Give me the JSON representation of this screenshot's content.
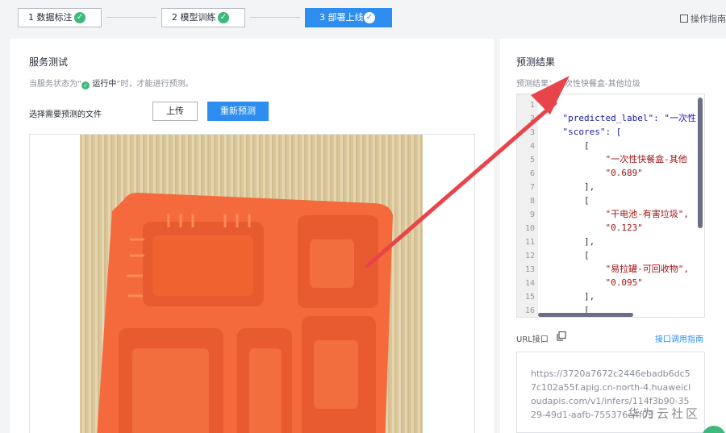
{
  "steps": [
    {
      "label": "1 数据标注",
      "status": "done"
    },
    {
      "label": "2 模型训练",
      "status": "done"
    },
    {
      "label": "3 部署上线",
      "status": "active"
    }
  ],
  "guide_label": "操作指南",
  "service_test": {
    "title": "服务测试",
    "hint_prefix": "当服务状态为“",
    "hint_status": "运行中",
    "hint_suffix": "”时，才能进行预测。",
    "file_label": "选择需要预测的文件",
    "upload_label": "上传",
    "repredict_label": "重新预测"
  },
  "result": {
    "title": "预测结果",
    "text": "预测结果：一次性快餐盒-其他垃圾",
    "code_lines": [
      {
        "n": "1",
        "t": "{"
      },
      {
        "n": "2",
        "t": "    \"predicted_label\": \"一次性"
      },
      {
        "n": "3",
        "t": "    \"scores\": ["
      },
      {
        "n": "4",
        "t": "        ["
      },
      {
        "n": "5",
        "t": "            \"一次性快餐盒-其他"
      },
      {
        "n": "6",
        "t": "            \"0.689\""
      },
      {
        "n": "7",
        "t": "        ],"
      },
      {
        "n": "8",
        "t": "        ["
      },
      {
        "n": "9",
        "t": "            \"干电池-有害垃圾\","
      },
      {
        "n": "10",
        "t": "            \"0.123\""
      },
      {
        "n": "11",
        "t": "        ],"
      },
      {
        "n": "12",
        "t": "        ["
      },
      {
        "n": "13",
        "t": "            \"易拉罐-可回收物\","
      },
      {
        "n": "14",
        "t": "            \"0.095\""
      },
      {
        "n": "15",
        "t": "        ],"
      },
      {
        "n": "16",
        "t": "        ["
      }
    ]
  },
  "url_section": {
    "label": "URL接口",
    "link": "接口调用指南",
    "url": "https://3720a7672c2446ebadb6dc57c102a55f.apig.cn-north-4.huaweicloudapis.com/v1/infers/114f3b90-3529-49d1-aafb-755376e4f03"
  },
  "watermark": "华为云社区",
  "colors": {
    "primary": "#2e8ef0",
    "success": "#3fb87c",
    "arrow": "#e8454a",
    "tray": "#f46a3c"
  }
}
